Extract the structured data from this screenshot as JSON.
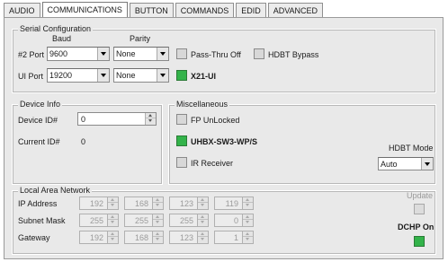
{
  "tabs": [
    {
      "label": "AUDIO",
      "active": false
    },
    {
      "label": "COMMUNICATIONS",
      "active": true
    },
    {
      "label": "BUTTON",
      "active": false
    },
    {
      "label": "COMMANDS",
      "active": false
    },
    {
      "label": "EDID",
      "active": false
    },
    {
      "label": "ADVANCED",
      "active": false
    }
  ],
  "serial": {
    "title": "Serial Configuration",
    "baud_header": "Baud",
    "parity_header": "Parity",
    "port2_label": "#2 Port",
    "port2_baud": "9600",
    "port2_parity": "None",
    "ui_port_label": "UI Port",
    "ui_baud": "19200",
    "ui_parity": "None",
    "pass_thru_label": "Pass-Thru Off",
    "hdbt_bypass_label": "HDBT Bypass",
    "x21_label": "X21-UI"
  },
  "device": {
    "title": "Device Info",
    "device_id_label": "Device ID#",
    "device_id_value": "0",
    "current_id_label": "Current ID#",
    "current_id_value": "0"
  },
  "misc": {
    "title": "Miscellaneous",
    "fp_unlocked_label": "FP UnLocked",
    "model_label": "UHBX-SW3-WP/S",
    "ir_receiver_label": "IR Receiver",
    "hdbt_mode_label": "HDBT Mode",
    "hdbt_mode_value": "Auto"
  },
  "lan": {
    "title": "Local Area Network",
    "ip_label": "IP Address",
    "subnet_label": "Subnet Mask",
    "gateway_label": "Gateway",
    "ip": [
      "192",
      "168",
      "123",
      "119"
    ],
    "subnet": [
      "255",
      "255",
      "255",
      "0"
    ],
    "gateway": [
      "192",
      "168",
      "123",
      "1"
    ],
    "update_label": "Update",
    "dhcp_label": "DCHP On"
  },
  "colors": {
    "led_on": "#33b34a",
    "led_off": "#d8d8d8"
  }
}
